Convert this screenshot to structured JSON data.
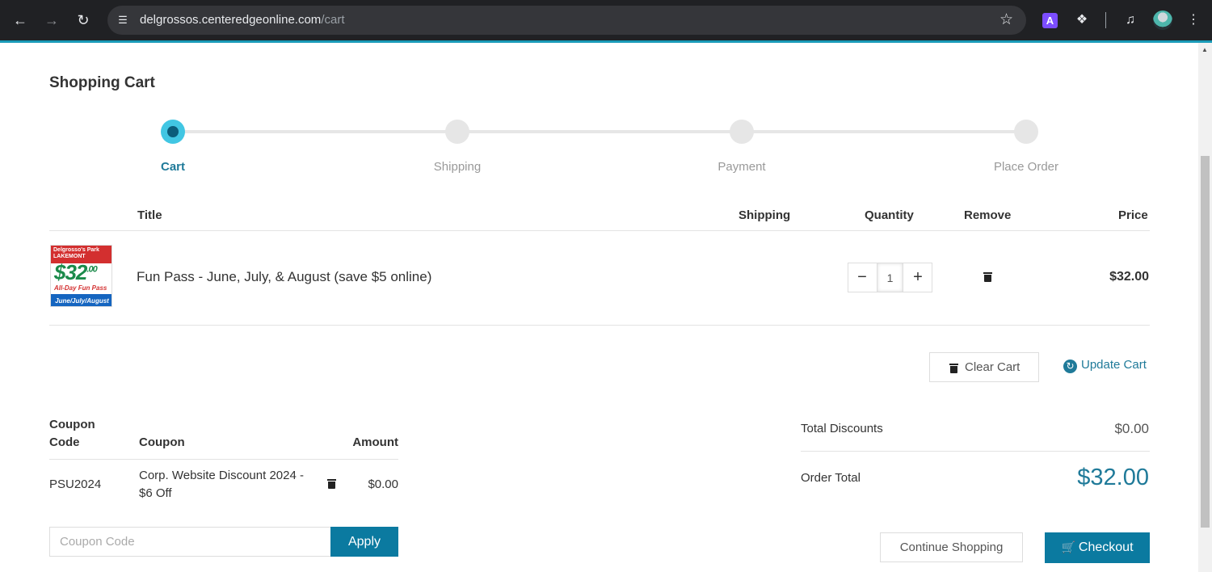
{
  "browser": {
    "url_host": "delgrossos.centeredgeonline.com",
    "url_path": "/cart",
    "ext_label": "A",
    "icons": [
      "back-arrow-icon",
      "forward-arrow-icon",
      "reload-icon",
      "site-info-icon",
      "bookmark-star-icon",
      "extension-a-icon",
      "extensions-puzzle-icon",
      "media-control-icon",
      "profile-avatar-icon",
      "kebab-menu-icon"
    ]
  },
  "page": {
    "title": "Shopping Cart"
  },
  "steps": [
    {
      "label": "Cart",
      "active": true
    },
    {
      "label": "Shipping",
      "active": false
    },
    {
      "label": "Payment",
      "active": false
    },
    {
      "label": "Place Order",
      "active": false
    }
  ],
  "cart_table": {
    "headers": {
      "title": "Title",
      "shipping": "Shipping",
      "quantity": "Quantity",
      "remove": "Remove",
      "price": "Price"
    },
    "items": [
      {
        "title": "Fun Pass - June, July, & August (save $5 online)",
        "quantity": "1",
        "price": "$32.00",
        "image": {
          "top_text": "Delgrosso's Park LAKEMONT",
          "price_text": "$32",
          "price_cents": ".00",
          "tagline": "All-Day Fun Pass",
          "months": "June/July/August"
        }
      }
    ]
  },
  "actions": {
    "clear_cart": "Clear Cart",
    "update_cart": "Update Cart"
  },
  "coupons": {
    "headers": {
      "code_line1": "Coupon",
      "code_line2": "Code",
      "coupon": "Coupon",
      "amount": "Amount"
    },
    "rows": [
      {
        "code": "PSU2024",
        "name_line1": "Corp. Website Discount 2024 -",
        "name_line2": "$6 Off",
        "amount": "$0.00"
      }
    ],
    "input_placeholder": "Coupon Code",
    "apply_label": "Apply"
  },
  "summary": {
    "total_discounts_label": "Total Discounts",
    "total_discounts_value": "$0.00",
    "order_total_label": "Order Total",
    "order_total_value": "$32.00"
  },
  "footer_buttons": {
    "continue_shopping": "Continue Shopping",
    "checkout": "Checkout"
  },
  "colors": {
    "accent": "#1f7a99",
    "primary_button": "#0b7aa0",
    "step_active": "#41c6e3"
  }
}
